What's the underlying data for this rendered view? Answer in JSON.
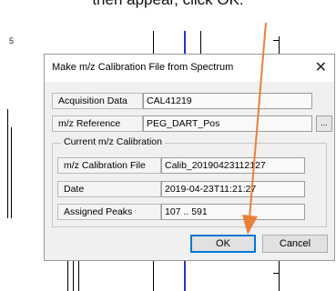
{
  "caption": "then appear, click OK.",
  "background": {
    "axis_label": "5"
  },
  "dialog": {
    "title": "Make m/z Calibration File from Spectrum",
    "close_glyph": "✕",
    "acquisition": {
      "label": "Acquisition Data",
      "value": "CAL41219"
    },
    "reference": {
      "label": "m/z Reference",
      "value": "PEG_DART_Pos",
      "browse_label": "..."
    },
    "group": {
      "legend": "Current m/z Calibration",
      "calibration_file": {
        "label": "m/z Calibration File",
        "value": "Calib_20190423112127"
      },
      "date": {
        "label": "Date",
        "value": "2019-04-23T11:21:27"
      },
      "assigned_peaks": {
        "label": "Assigned Peaks",
        "value": "107 .. 591"
      }
    },
    "ok_label": "OK",
    "cancel_label": "Cancel"
  },
  "colors": {
    "arrow": "#e8803a",
    "ok_focus": "#0078d7",
    "spectrum_peak": "#2233cc"
  }
}
